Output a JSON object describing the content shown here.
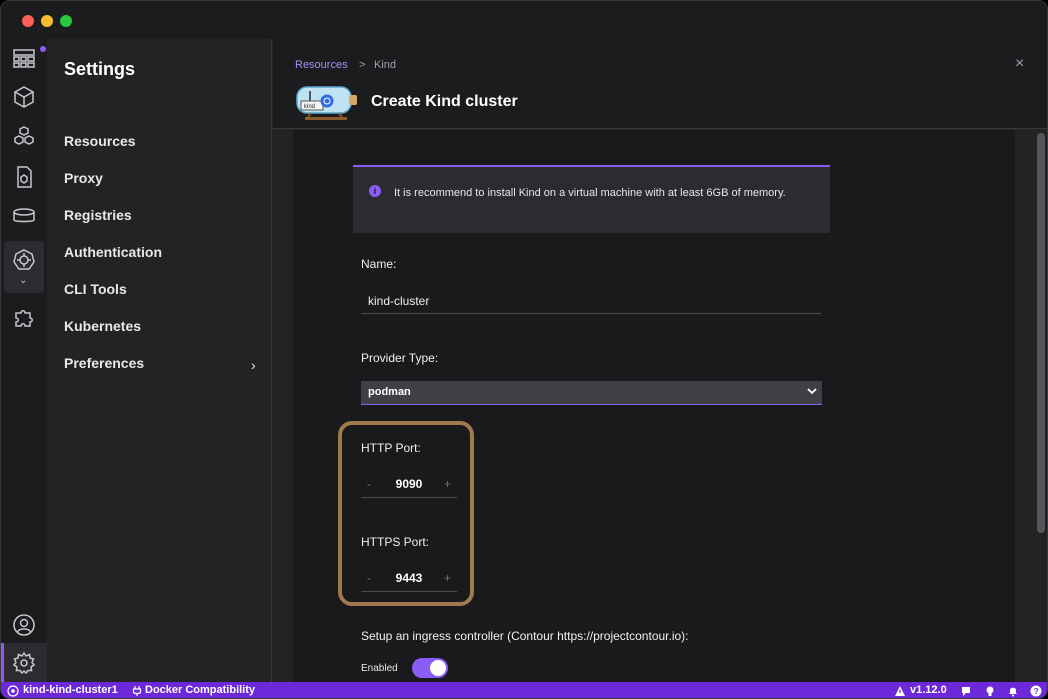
{
  "sidebar_nav": {
    "title": "Settings",
    "items": [
      {
        "label": "Resources"
      },
      {
        "label": "Proxy"
      },
      {
        "label": "Registries"
      },
      {
        "label": "Authentication"
      },
      {
        "label": "CLI Tools"
      },
      {
        "label": "Kubernetes"
      },
      {
        "label": "Preferences"
      }
    ],
    "preferences_chevron": "›"
  },
  "rail": {
    "icons": [
      "dashboard-icon",
      "containers-icon",
      "pods-icon",
      "images-icon",
      "volumes-icon",
      "kubernetes-icon",
      "extensions-icon",
      "account-icon",
      "settings-icon"
    ],
    "accent": "#8b5cf6"
  },
  "breadcrumb": {
    "link": "Resources",
    "separator": ">",
    "current": "Kind"
  },
  "header": {
    "title": "Create Kind cluster",
    "close": "×",
    "logo_text": "kind"
  },
  "alert": {
    "icon": "i",
    "text": "It is recommend to install Kind on a virtual machine with at least 6GB of memory."
  },
  "form": {
    "name_label": "Name:",
    "name_value": "kind-cluster",
    "provider_label": "Provider Type:",
    "provider_value": "podman",
    "http_label": "HTTP Port:",
    "http_value": "9090",
    "https_label": "HTTPS Port:",
    "https_value": "9443",
    "stepper_minus": "-",
    "stepper_plus": "+",
    "ingress_label": "Setup an ingress controller (Contour https://projectcontour.io):",
    "ingress_toggle_label": "Enabled",
    "ingress_enabled": true
  },
  "statusbar": {
    "context": "kind-kind-cluster1",
    "docker": "Docker Compatibility",
    "version": "v1.12.0",
    "color": "#6d28d9"
  }
}
